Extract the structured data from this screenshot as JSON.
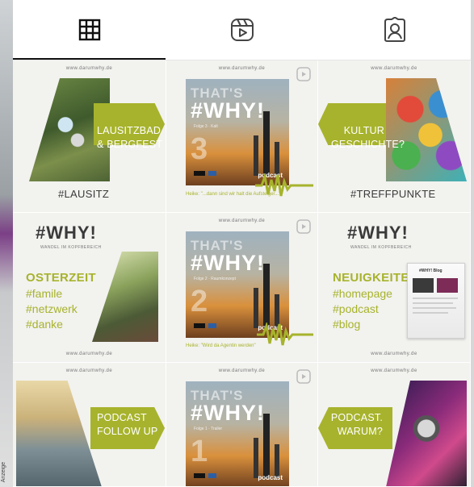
{
  "side": {
    "vertical_text": "Anzeige"
  },
  "tabs": [
    {
      "name": "grid",
      "icon": "grid-icon",
      "active": true
    },
    {
      "name": "reels",
      "icon": "reels-icon",
      "active": false
    },
    {
      "name": "tagged",
      "icon": "tagged-user-icon",
      "active": false
    }
  ],
  "posts": {
    "url": "www.darumwhy.de",
    "lausitz": {
      "banner": [
        "LAUSITZBAD",
        "& BERGFEST"
      ],
      "hashtag": "#LAUSITZ"
    },
    "podcast3": {
      "thats": "THAT'S",
      "why": "#WHY!",
      "folge": "Folge 3 · Kalt",
      "number": "3",
      "label": "podcast",
      "quote": "Heike: \"...dann sind wir halt die Aufsteiger...\""
    },
    "kultur": {
      "banner": [
        "KULTUR",
        "GESCHICHTE?"
      ],
      "hashtag": "#TREFFPUNKTE"
    },
    "osterzeit": {
      "logo": "#WHY!",
      "sub": "WANDEL IM KOPFBEREICH",
      "heading": "OSTERZEIT",
      "lines": [
        "#famile",
        "#netzwerk",
        "#danke"
      ]
    },
    "podcast2": {
      "thats": "THAT'S",
      "why": "#WHY!",
      "folge": "Folge 2 · Raumkonzept",
      "number": "2",
      "label": "podcast",
      "quote": "Heike: \"Wird da Agentin werden\""
    },
    "neuigkeiten": {
      "logo": "#WHY!",
      "sub": "WANDEL IM KOPFBEREICH",
      "heading": "NEUIGKEITEN",
      "lines": [
        "#homepage",
        "#podcast",
        "#blog"
      ],
      "blog_title": "#WHY! Blog"
    },
    "followup": {
      "banner": [
        "PODCAST",
        "FOLLOW UP"
      ]
    },
    "podcast1": {
      "thats": "THAT'S",
      "why": "#WHY!",
      "folge": "Folge 1 · Trailer",
      "number": "1",
      "label": "podcast"
    },
    "warum": {
      "banner": [
        "PODCAST.",
        "WARUM?"
      ]
    }
  },
  "colors": {
    "accent": "#a7b32c",
    "text": "#3a3a3a"
  }
}
